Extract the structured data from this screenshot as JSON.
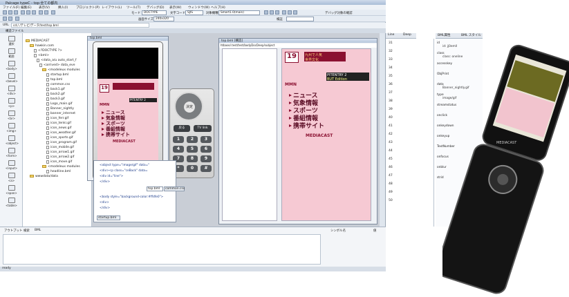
{
  "app": {
    "title": "Palcage typeC - top:全ての都内",
    "menus": [
      "ファイル(F)",
      "編集(E)",
      "表示(V)",
      "挿入(I)",
      "プロジェクト(P)",
      "レイアウト(L)",
      "ツール(T)",
      "デバッグ(D)",
      "表示(W)",
      "ウィンドウ(W)",
      "ヘルプ(H)"
    ],
    "toolbar_mode_label": "モード",
    "toolbar_mode_value": "DOCTYPE",
    "toolbar_enc_label": "文字コード",
    "toolbar_enc_value": "SJIS",
    "toolbar_target_label": "対象機種",
    "toolbar_target_value": "Smart1.0(main)",
    "toolbar_debug_label": "デバッグ対象の確認",
    "toolbar_size_label": "画面サイズ",
    "toolbar_size_value": "240x320",
    "toolbar_check_label": "検証",
    "url_label": "URL",
    "url_value": "cd:/ /テレビ/データ/test/top.bml",
    "tab_label": "構造ファイル"
  },
  "toolbox": {
    "items": [
      "選択",
      "範囲",
      "<body>",
      "<bevel>",
      "<div>",
      "<p>",
      "<br>",
      "<img>",
      "<object>",
      "<form>",
      "<input>",
      "<a>",
      "<span>",
      "<table>"
    ]
  },
  "tree": {
    "items": [
      "MEDIACAST",
      "hawkin.com",
      "<?DOCTYPE ?>",
      "<bml>",
      "<data_a/u auto_start_f",
      "<arrived> data_eve",
      "<modeleux modules",
      "startup.bml",
      "top.bml",
      "common.css",
      "back1.gif",
      "back2.gif",
      "back3.gif",
      "Logo_main.gif",
      "Banner_nightly",
      "banner_internet",
      "icon_ferr.gif",
      "icon_tenki.gif",
      "icon_news.gif",
      "icon_weather.gif",
      "icon_sports.gif",
      "icon_program.gif",
      "icon_mobile.gif",
      "icon_arrow1.gif",
      "icon_arrow2.gif",
      "icon_move.gif",
      "<modeleux modules",
      "headline.bml",
      "wwwdata/data"
    ]
  },
  "windows": {
    "top_bml": "top.bml",
    "code_top": "top.bml",
    "code_common": "common.css",
    "startup": "startup.bml",
    "tree_window": "top.bml [構造]",
    "tree_path": "htbase/.test/test/bodyDocDeep/subject",
    "grid_tab1": "Line",
    "grid_tab2": "Deep"
  },
  "phone_screens": {
    "channel": "19",
    "station": "MMN",
    "header1": "九州で人気",
    "header2": "世界文化",
    "pitentry": "PITENTRY 2",
    "pitentry_sub": "BUT Edition",
    "items": [
      "ニュース",
      "気象情報",
      "スポーツ",
      "番組情報",
      "携帯サイト"
    ],
    "brand": "MEDIACAST",
    "keypad_center": "決定",
    "key_back": "戻る",
    "key_tvlink": "TV link",
    "keys": [
      "1",
      "2",
      "3",
      "4",
      "5",
      "6",
      "7",
      "8",
      "9",
      "*",
      "0",
      "#"
    ]
  },
  "properties": {
    "title1": "BML属性",
    "title2": "BML スタイル",
    "rows": [
      "id",
      "class",
      "accesskey",
      "ObjPrint",
      "data",
      "type",
      "streamstatus",
      "onclick",
      "onkeydown",
      "onkeyup",
      "TextNumber",
      "onfocus",
      "onblur",
      "strid"
    ],
    "values": [
      "id: jj0emll",
      "class: oneline",
      "",
      "",
      "Banner_nightly.gif",
      "image/gif",
      "",
      "",
      "",
      "",
      "",
      "",
      "",
      ""
    ],
    "col_numbers": [
      "31",
      "32",
      "33",
      "34",
      "35",
      "36",
      "37",
      "38",
      "39",
      "40",
      "41",
      "42",
      "43",
      "44",
      "45",
      "46",
      "47",
      "48",
      "49",
      "50"
    ]
  },
  "bottom": {
    "tabs": [
      "アウトプット",
      "検索",
      "BML"
    ],
    "right_head1": "シンボル名",
    "right_head2": "値"
  },
  "status": {
    "text": "ready"
  },
  "code_lines": [
    "<object type=\"image/gif\" data=\"",
    "<div><p class=\"ceBack\" data=",
    "<div id=\"line\">",
    "</div>",
    "<body style=\"background-color:#ffdfe0\">",
    "<div>",
    "</div>"
  ],
  "colors": {
    "accent": "#2d6fd1",
    "pink": "#f6c9d3",
    "maroon": "#8a1030"
  }
}
